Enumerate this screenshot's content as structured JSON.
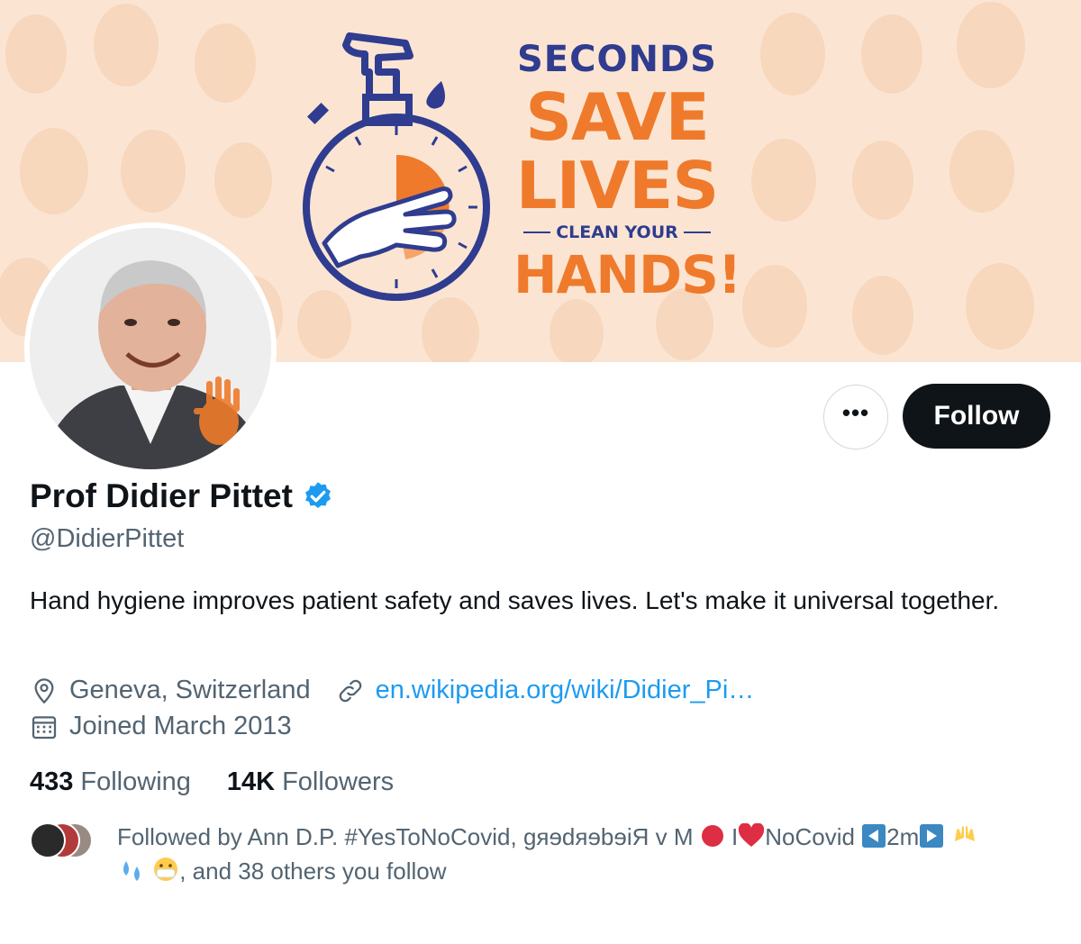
{
  "banner": {
    "line1": "SECONDS",
    "line2": "SAVE",
    "line3": "LIVES",
    "line4": "CLEAN YOUR",
    "line5": "HANDS!"
  },
  "profile": {
    "display_name": "Prof Didier Pittet",
    "handle": "@DidierPittet",
    "bio": "Hand hygiene improves patient safety and saves lives. Let's make it universal together.",
    "location": "Geneva, Switzerland",
    "website": "en.wikipedia.org/wiki/Didier_Pi…",
    "joined": "Joined March 2013",
    "verified": true
  },
  "actions": {
    "more_label": "•••",
    "follow_label": "Follow"
  },
  "stats": {
    "following_count": "433",
    "following_label": "Following",
    "followers_count": "14K",
    "followers_label": "Followers"
  },
  "followed_by": {
    "prefix": "Followed by Ann D.P. #YesToNoCovid, ɡяɘdяɘbɘiЯ v M",
    "part2": "I",
    "part3": "NoCovid",
    "part4": "2m",
    "suffix": ", and 38 others you follow"
  },
  "colors": {
    "accent": "#1d9bf0",
    "banner_bg": "#fbe5d2",
    "banner_orange": "#ef7a2b",
    "banner_navy": "#2f3c8f",
    "text_primary": "#0f1419",
    "text_secondary": "#536471"
  },
  "icons": {
    "location": "map-pin-icon",
    "link": "link-icon",
    "calendar": "calendar-icon",
    "verified": "verified-badge-icon"
  }
}
